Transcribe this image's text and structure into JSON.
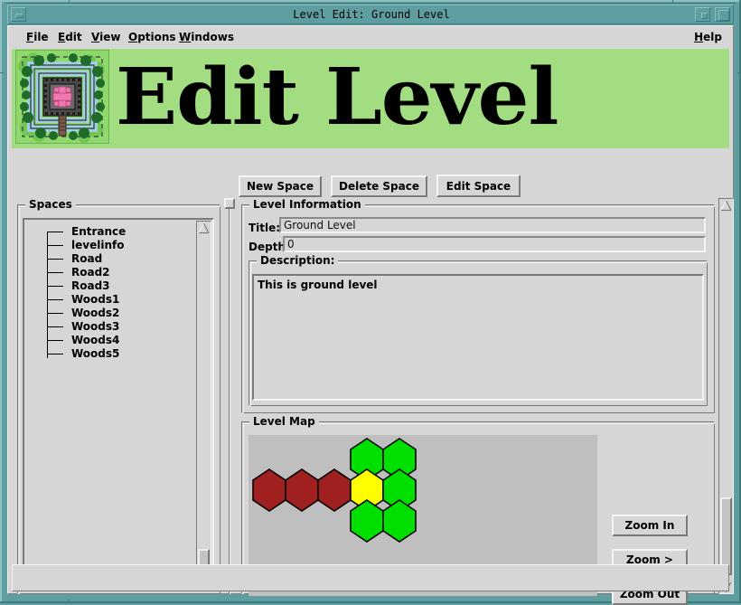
{
  "window": {
    "title": "Level Edit: Ground Level",
    "controls": {
      "minimize": "minimize",
      "restore": "restore",
      "maximize": "maximize"
    }
  },
  "menu": {
    "items": [
      {
        "label": "File",
        "mnemonic": "F",
        "rest": "ile"
      },
      {
        "label": "Edit",
        "mnemonic": "E",
        "rest": "dit"
      },
      {
        "label": "View",
        "mnemonic": "V",
        "rest": "iew"
      },
      {
        "label": "Options",
        "mnemonic": "O",
        "rest": "ptions"
      },
      {
        "label": "Windows",
        "mnemonic": "W",
        "rest": "indows"
      }
    ],
    "help": {
      "label": "Help",
      "mnemonic": "H",
      "rest": "elp"
    }
  },
  "banner": {
    "heading": "Edit Level",
    "background_color": "#a3dd82",
    "thumbnail_alt": "castle-map-illustration"
  },
  "toolbar": {
    "new_space_label": "New Space",
    "delete_space_label": "Delete Space",
    "edit_space_label": "Edit Space"
  },
  "spaces": {
    "group_title": "Spaces",
    "items": [
      {
        "label": "Entrance"
      },
      {
        "label": "levelinfo"
      },
      {
        "label": "Road"
      },
      {
        "label": "Road2"
      },
      {
        "label": "Road3"
      },
      {
        "label": "Woods1"
      },
      {
        "label": "Woods2"
      },
      {
        "label": "Woods3"
      },
      {
        "label": "Woods4"
      },
      {
        "label": "Woods5"
      }
    ]
  },
  "level_information": {
    "group_title": "Level Information",
    "title_label": "Title:",
    "title_value": "Ground Level",
    "title_placeholder": "",
    "depth_label": "Depth:",
    "depth_value": "0",
    "depth_placeholder": "",
    "description_label": "Description:",
    "description_value": "This is ground level",
    "description_placeholder": ""
  },
  "level_map": {
    "group_title": "Level Map",
    "canvas_background": "#bfbfbf",
    "zoom_in_label": "Zoom In",
    "zoom_pan_label": "Zoom >",
    "zoom_out_label": "Zoom Out",
    "colors": {
      "road": "#a02020",
      "woods": "#00e000",
      "entrance": "#ffff00",
      "outline": "#000000"
    },
    "hexes": [
      {
        "name": "Road3",
        "col": 0,
        "row": 1,
        "color": "#a02020"
      },
      {
        "name": "Road2",
        "col": 1,
        "row": 1,
        "color": "#a02020"
      },
      {
        "name": "Road",
        "col": 2,
        "row": 1,
        "color": "#a02020"
      },
      {
        "name": "Woods1",
        "col": 3,
        "row": 0,
        "color": "#00e000"
      },
      {
        "name": "Woods2",
        "col": 4,
        "row": 0,
        "color": "#00e000"
      },
      {
        "name": "Entrance",
        "col": 3,
        "row": 1,
        "color": "#ffff00"
      },
      {
        "name": "Woods3",
        "col": 4,
        "row": 1,
        "color": "#00e000"
      },
      {
        "name": "Woods4",
        "col": 3,
        "row": 2,
        "color": "#00e000"
      },
      {
        "name": "Woods5",
        "col": 4,
        "row": 2,
        "color": "#00e000"
      }
    ]
  },
  "scrollbars": {
    "spaces_vertical": {
      "name": "spaces-scrollbar",
      "thumb_position": "bottom"
    },
    "main_vertical": {
      "name": "main-scrollbar",
      "thumb_position": "bottom"
    }
  }
}
